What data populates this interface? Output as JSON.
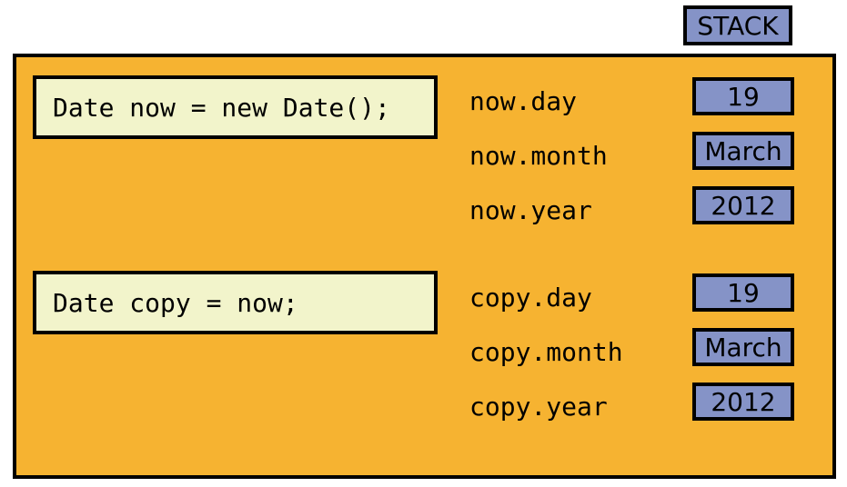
{
  "stack_label": "STACK",
  "code": {
    "line1": "Date now = new Date();",
    "line2": "Date copy = now;"
  },
  "fields": {
    "now_day_label": "now.day",
    "now_month_label": "now.month",
    "now_year_label": "now.year",
    "copy_day_label": "copy.day",
    "copy_month_label": "copy.month",
    "copy_year_label": "copy.year"
  },
  "values": {
    "now_day": "19",
    "now_month": "March",
    "now_year": "2012",
    "copy_day": "19",
    "copy_month": "March",
    "copy_year": "2012"
  }
}
